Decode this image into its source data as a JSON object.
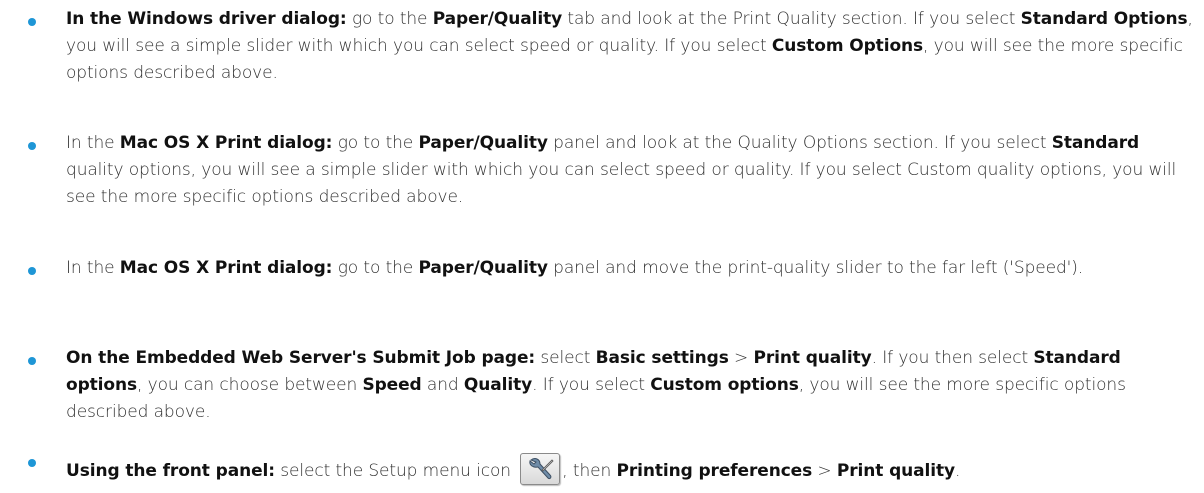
{
  "items": [
    {
      "parts": [
        {
          "t": "In the Windows driver dialog:",
          "b": true
        },
        {
          "t": " go to the "
        },
        {
          "t": "Paper/Quality",
          "b": true
        },
        {
          "t": " tab and look at the Print Quality section. If you select "
        },
        {
          "t": "Standard Options",
          "b": true
        },
        {
          "t": ", you will see a simple slider with which you can select speed or quality. If you select "
        },
        {
          "t": "Custom Options",
          "b": true
        },
        {
          "t": ", you will see the more specific options described above."
        }
      ]
    },
    {
      "parts": [
        {
          "t": "In the "
        },
        {
          "t": "Mac OS X Print dialog:",
          "b": true
        },
        {
          "t": " go to the "
        },
        {
          "t": "Paper/Quality",
          "b": true
        },
        {
          "t": " panel and look at the Quality Options section. If you select "
        },
        {
          "t": "Standard",
          "b": true
        },
        {
          "t": " quality options, you will see a simple slider with which you can select speed or quality. If you select Custom quality options, you will see the more specific options described above."
        }
      ]
    },
    {
      "parts": [
        {
          "t": "In the "
        },
        {
          "t": "Mac OS X Print dialog:",
          "b": true
        },
        {
          "t": " go to the "
        },
        {
          "t": "Paper/Quality",
          "b": true
        },
        {
          "t": " panel and move the print-quality slider to the far left ('Speed')."
        }
      ]
    },
    {
      "parts": [
        {
          "t": "On the Embedded Web Server's Submit Job page:",
          "b": true
        },
        {
          "t": " select "
        },
        {
          "t": "Basic settings",
          "b": true
        },
        {
          "t": " > "
        },
        {
          "t": "Print quality",
          "b": true
        },
        {
          "t": ". If you then select "
        },
        {
          "t": "Standard options",
          "b": true
        },
        {
          "t": ", you can choose between "
        },
        {
          "t": "Speed",
          "b": true
        },
        {
          "t": " and "
        },
        {
          "t": "Quality",
          "b": true
        },
        {
          "t": ". If you select "
        },
        {
          "t": "Custom options",
          "b": true
        },
        {
          "t": ", you will see the more specific options described above."
        }
      ]
    },
    {
      "parts": [
        {
          "t": "Using the front panel:",
          "b": true
        },
        {
          "t": " select the Setup menu icon "
        },
        {
          "icon": "wrench-icon"
        },
        {
          "t": ", then "
        },
        {
          "t": "Printing preferences",
          "b": true
        },
        {
          "t": " > "
        },
        {
          "t": "Print quality",
          "b": true
        },
        {
          "t": "."
        }
      ]
    }
  ],
  "colors": {
    "bullet": "#1e96d6",
    "text": "#303030"
  }
}
